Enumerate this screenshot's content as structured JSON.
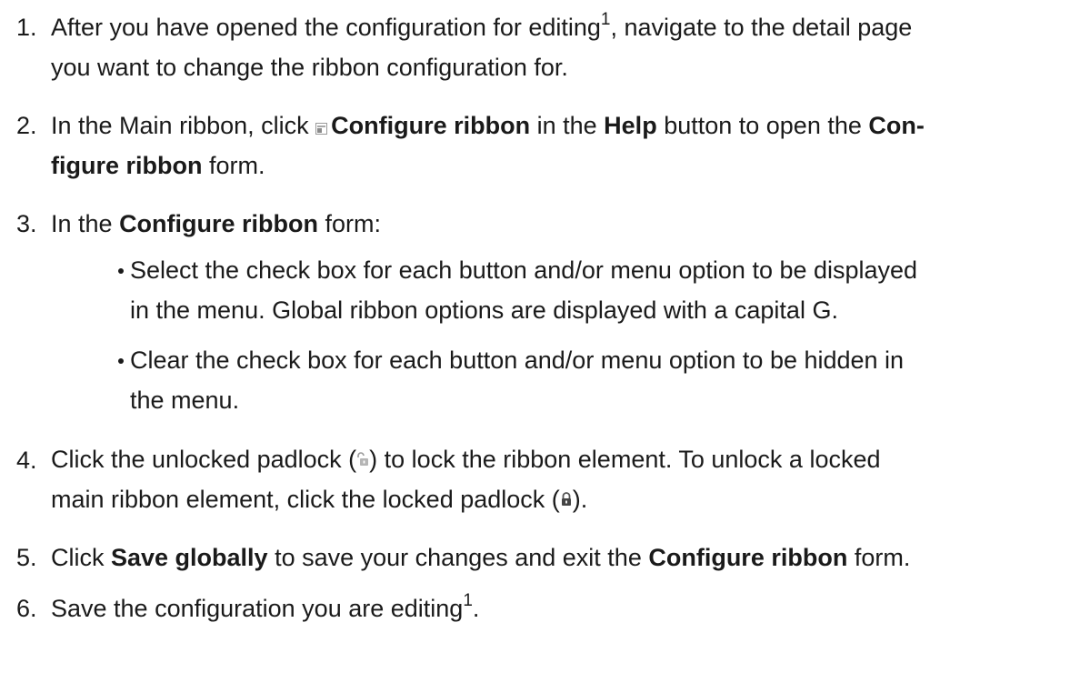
{
  "steps": [
    {
      "num": "1.",
      "text_a": "After you have opened the configuration for editing",
      "sup": "1",
      "text_b": ", navigate to the detail page",
      "line2": "you want to change the ribbon configuration for."
    },
    {
      "num": "2.",
      "text_a": "In the Main ribbon, click ",
      "bold_a": "Configure ribbon",
      "text_b": " in the ",
      "bold_b": "Help",
      "text_c": " button to open the ",
      "bold_c": "Con-",
      "bold_d": "figure ribbon",
      "text_d": " form."
    },
    {
      "num": "3.",
      "text_a": "In the ",
      "bold_a": "Configure ribbon",
      "text_b": " form:",
      "bullets": [
        {
          "line1": "Select the check box for each button and/or menu option to be displayed",
          "line2": "in the menu. Global ribbon options are displayed with a capital G."
        },
        {
          "line1": "Clear the check box for each button and/or menu option to be hidden in",
          "line2": "the menu."
        }
      ]
    },
    {
      "num": "4.",
      "text_a": "Click the unlocked padlock (",
      "text_b": ") to lock the ribbon element. To unlock a locked",
      "line2_a": "main ribbon element, click the locked padlock (",
      "line2_b": ")."
    },
    {
      "num": "5.",
      "text_a": "Click ",
      "bold_a": "Save globally",
      "text_b": " to save your changes and exit the ",
      "bold_b": "Configure ribbon",
      "text_c": " form."
    },
    {
      "num": "6.",
      "text_a": "Save the configuration you are editing",
      "sup": "1",
      "text_b": "."
    }
  ]
}
